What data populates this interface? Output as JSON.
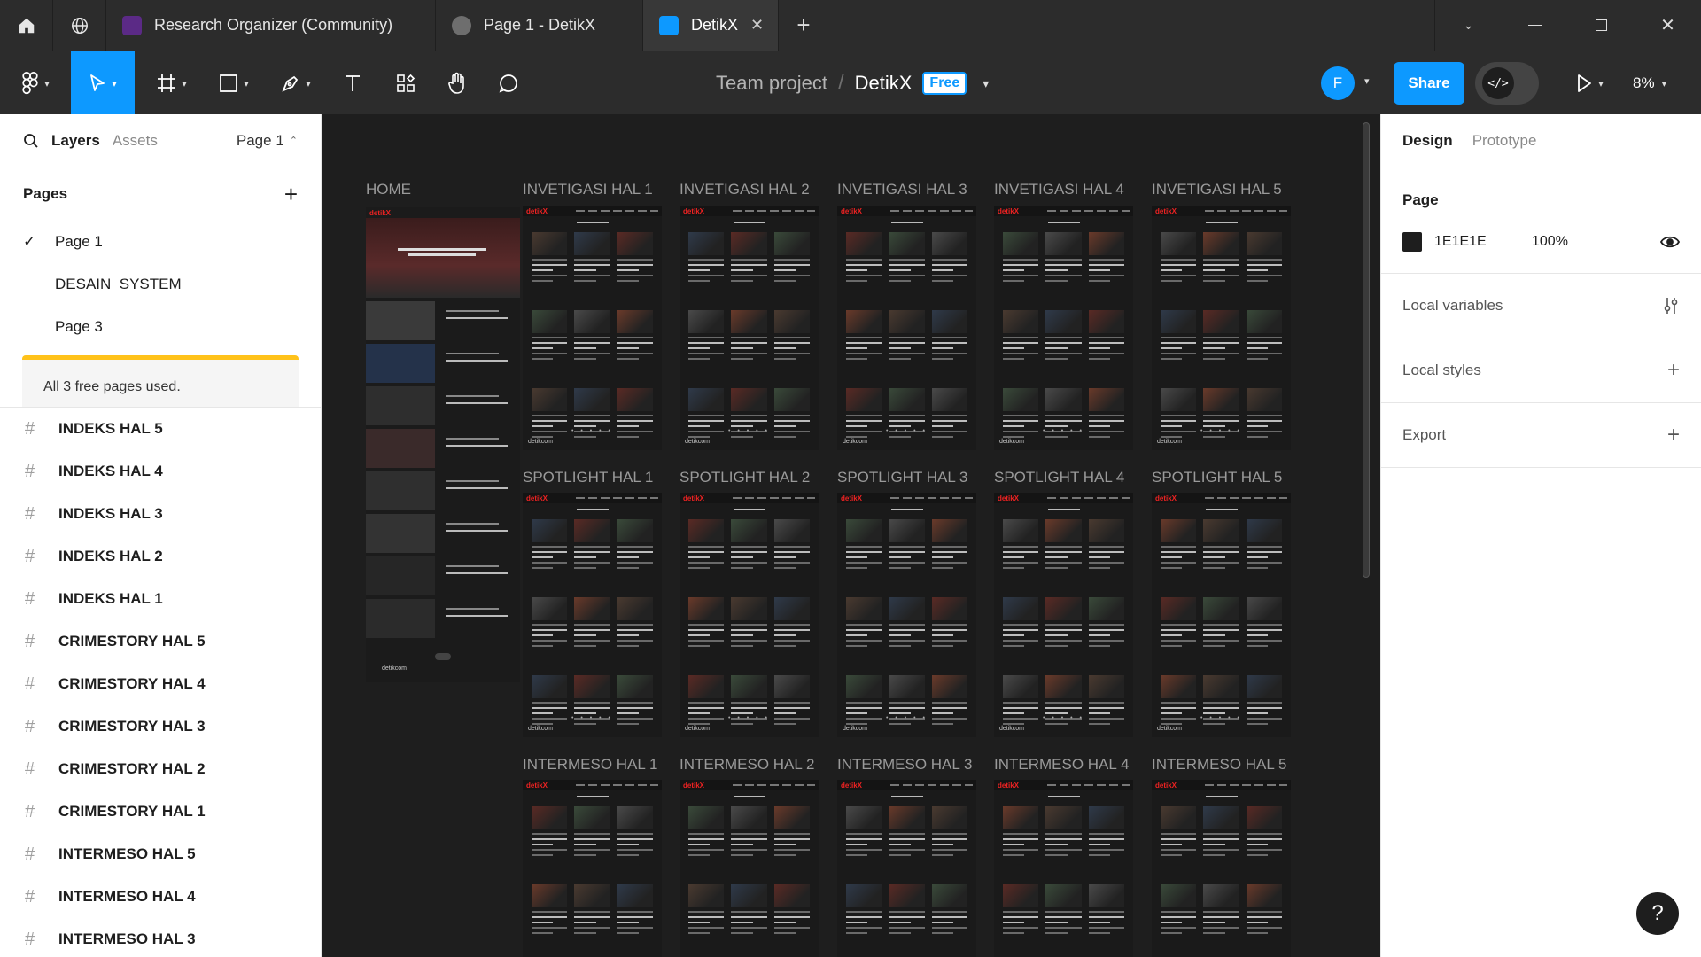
{
  "tabs": [
    {
      "label": "Research Organizer (Community)",
      "icon": "figjam-file-icon",
      "color": "#5b2a86"
    },
    {
      "label": "Page 1 - DetikX",
      "icon": "play-icon",
      "color": "#6e6e6e"
    },
    {
      "label": "DetikX",
      "icon": "figma-file-icon",
      "color": "#0d99ff"
    }
  ],
  "toolbar": {
    "team": "Team project",
    "separator": "/",
    "file": "DetikX",
    "plan_badge": "Free",
    "avatar_letter": "F",
    "share_label": "Share",
    "zoom": "8%"
  },
  "left_panel": {
    "layers_tab": "Layers",
    "assets_tab": "Assets",
    "page_selector": "Page 1",
    "pages_title": "Pages",
    "pages": [
      "Page 1",
      "DESAIN  SYSTEM",
      "Page 3"
    ],
    "limit_text": "All 3 free pages used.",
    "layers": [
      "INDEKS HAL 5",
      "INDEKS HAL 4",
      "INDEKS HAL 3",
      "INDEKS HAL 2",
      "INDEKS HAL 1",
      "CRIMESTORY HAL 5",
      "CRIMESTORY HAL 4",
      "CRIMESTORY HAL 3",
      "CRIMESTORY HAL 2",
      "CRIMESTORY HAL 1",
      "INTERMESO HAL 5",
      "INTERMESO HAL 4",
      "INTERMESO HAL 3"
    ]
  },
  "canvas": {
    "home_label": "HOME",
    "row1": [
      "INVETIGASI HAL 1",
      "INVETIGASI HAL 2",
      "INVETIGASI HAL 3",
      "INVETIGASI HAL 4",
      "INVETIGASI HAL 5"
    ],
    "row2": [
      "SPOTLIGHT HAL 1",
      "SPOTLIGHT HAL 2",
      "SPOTLIGHT HAL 3",
      "SPOTLIGHT HAL 4",
      "SPOTLIGHT HAL 5"
    ],
    "row3": [
      "INTERMESO HAL 1",
      "INTERMESO HAL 2",
      "INTERMESO HAL 3",
      "INTERMESO HAL 4",
      "INTERMESO HAL 5"
    ],
    "frame_logo": "detikX",
    "frame_footer": "detikcom"
  },
  "right_panel": {
    "design_tab": "Design",
    "prototype_tab": "Prototype",
    "page_title": "Page",
    "page_color": "1E1E1E",
    "page_opacity": "100%",
    "local_variables": "Local variables",
    "local_styles": "Local styles",
    "export": "Export"
  },
  "help_label": "?"
}
